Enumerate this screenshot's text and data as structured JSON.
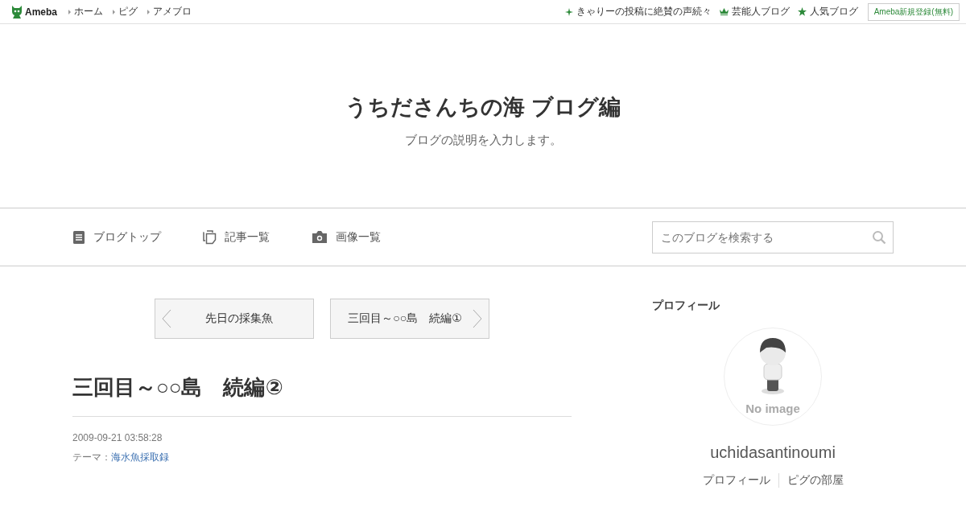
{
  "header": {
    "logo": "Ameba",
    "nav": [
      "ホーム",
      "ピグ",
      "アメブロ"
    ],
    "links": [
      {
        "kind": "sparkle",
        "label": "きゃりーの投稿に絶賛の声続々"
      },
      {
        "kind": "crown",
        "label": "芸能人ブログ"
      },
      {
        "kind": "star",
        "label": "人気ブログ"
      }
    ],
    "register": "Ameba新規登録(無料)"
  },
  "blog": {
    "title": "うちださんちの海 ブログ編",
    "description": "ブログの説明を入力します。"
  },
  "menu": [
    {
      "kind": "doc",
      "label": "ブログトップ"
    },
    {
      "kind": "copy",
      "label": "記事一覧"
    },
    {
      "kind": "camera",
      "label": "画像一覧"
    }
  ],
  "search": {
    "placeholder": "このブログを検索する"
  },
  "pager": {
    "prev": "先日の採集魚",
    "next": "三回目～○○島　続編①"
  },
  "article": {
    "title": "三回目～○○島　続編②",
    "date": "2009-09-21 03:58:28",
    "theme_label": "テーマ：",
    "theme": "海水魚採取録"
  },
  "profile": {
    "heading": "プロフィール",
    "avatar_text": "No image",
    "name": "uchidasantinoumi",
    "links": [
      "プロフィール",
      "ピグの部屋"
    ]
  }
}
